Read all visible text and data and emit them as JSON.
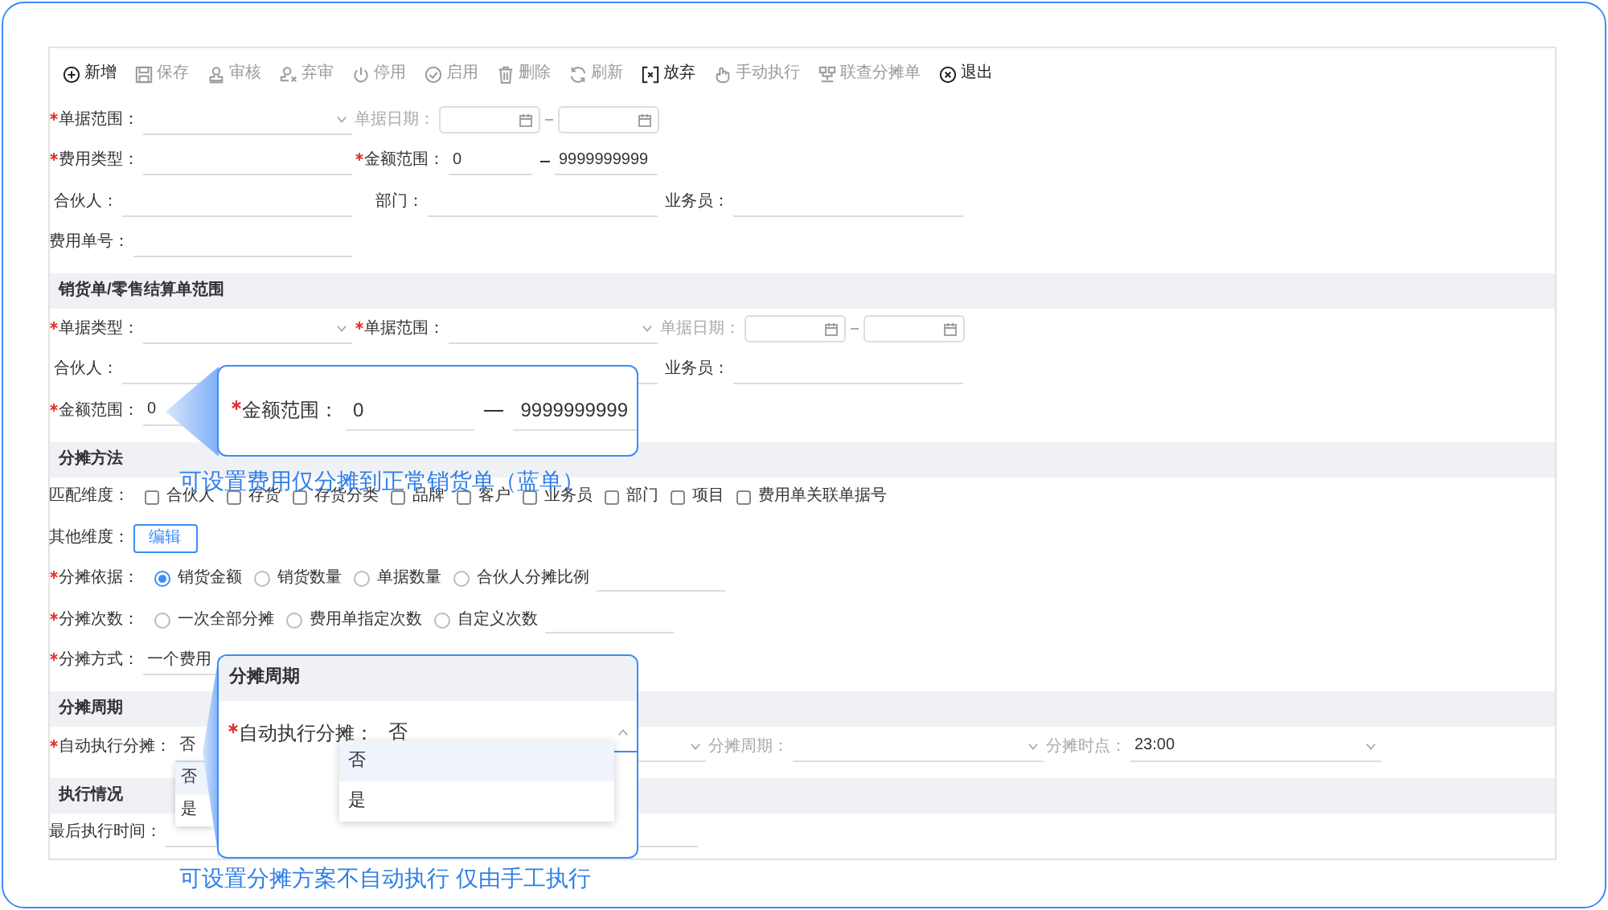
{
  "toolbar": [
    {
      "label": "新增",
      "disabled": false
    },
    {
      "label": "保存",
      "disabled": true
    },
    {
      "label": "审核",
      "disabled": true
    },
    {
      "label": "弃审",
      "disabled": true
    },
    {
      "label": "停用",
      "disabled": true
    },
    {
      "label": "启用",
      "disabled": true
    },
    {
      "label": "删除",
      "disabled": true
    },
    {
      "label": "刷新",
      "disabled": true
    },
    {
      "label": "放弃",
      "disabled": false
    },
    {
      "label": "手动执行",
      "disabled": true
    },
    {
      "label": "联查分摊单",
      "disabled": true
    },
    {
      "label": "退出",
      "disabled": false
    }
  ],
  "sections": [
    {
      "rows": [
        [
          {
            "kind": "select",
            "label": "单据范围：",
            "required": true
          },
          {
            "kind": "date_range",
            "label": "单据日期：",
            "required": false,
            "disabled": true
          }
        ],
        [
          {
            "kind": "text",
            "label": "费用类型：",
            "required": true
          },
          {
            "kind": "range",
            "label": "金额范围：",
            "required": true,
            "min": "0",
            "max": "9999999999"
          }
        ],
        [
          {
            "kind": "text",
            "label": "合伙人：",
            "required": false
          },
          {
            "kind": "text",
            "label": "部门：",
            "required": false
          },
          {
            "kind": "text",
            "label": "业务员：",
            "required": false
          }
        ],
        [
          {
            "kind": "text",
            "label": "费用单号：",
            "required": false
          }
        ]
      ]
    },
    {
      "title": "销货单/零售结算单范围",
      "rows": [
        [
          {
            "kind": "select",
            "label": "单据类型：",
            "required": true
          },
          {
            "kind": "select",
            "label": "单据范围：",
            "required": true
          },
          {
            "kind": "date_range",
            "label": "单据日期：",
            "required": false,
            "disabled": true
          }
        ],
        [
          {
            "kind": "text",
            "label": "合伙人：",
            "required": false
          },
          {
            "kind": "text"
          },
          {
            "kind": "text",
            "label": "业务员：",
            "required": false
          }
        ],
        [
          {
            "kind": "range",
            "label": "金额范围：",
            "required": true,
            "min": "0"
          }
        ]
      ]
    },
    {
      "title": "分摊方法",
      "rows": [
        [
          {
            "kind": "checkboxes",
            "label": "匹配维度：",
            "required": false,
            "options": [
              {
                "label": "合伙人",
                "checked": false
              },
              {
                "label": "存货",
                "checked": false
              },
              {
                "label": "存货分类",
                "checked": false
              },
              {
                "label": "品牌",
                "checked": false
              },
              {
                "label": "客户",
                "checked": false
              },
              {
                "label": "业务员",
                "checked": false
              },
              {
                "label": "部门",
                "checked": false
              },
              {
                "label": "项目",
                "checked": false
              },
              {
                "label": "费用单关联单据号",
                "checked": false
              }
            ]
          }
        ],
        [
          {
            "kind": "button",
            "label": "其他维度：",
            "required": false,
            "button": "编辑"
          }
        ],
        [
          {
            "kind": "radios",
            "label": "分摊依据：",
            "required": true,
            "input": true,
            "options": [
              {
                "label": "销货金额",
                "selected": true
              },
              {
                "label": "销货数量",
                "selected": false
              },
              {
                "label": "单据数量",
                "selected": false
              },
              {
                "label": "合伙人分摊比例",
                "selected": false
              }
            ]
          }
        ],
        [
          {
            "kind": "radios",
            "label": "分摊次数：",
            "required": true,
            "input": true,
            "options": [
              {
                "label": "一次全部分摊",
                "selected": false
              },
              {
                "label": "费用单指定次数",
                "selected": false
              },
              {
                "label": "自定义次数",
                "selected": false
              }
            ]
          }
        ],
        [
          {
            "kind": "text",
            "label": "分摊方式：",
            "required": true,
            "value": "一个费用"
          }
        ]
      ]
    },
    {
      "title": "分摊周期",
      "rows": [
        [
          {
            "kind": "select",
            "label": "自动执行分摊：",
            "required": true,
            "value": "否",
            "open": true,
            "options": [
              {
                "label": "否",
                "selected": true
              },
              {
                "label": "是",
                "selected": false
              }
            ]
          },
          {
            "kind": "select",
            "label": "分摊周期：",
            "required": false,
            "disabled": true
          },
          {
            "kind": "select",
            "label": "分摊时点：",
            "required": false,
            "disabled": true,
            "value": "23:00"
          }
        ]
      ]
    },
    {
      "title": "执行情况",
      "rows": [
        [
          {
            "kind": "text",
            "label": "最后执行时间：",
            "required": false
          }
        ]
      ]
    }
  ],
  "callouts": [
    {
      "caption": "可设置费用仅分摊到正常销货单（蓝单）",
      "field": {
        "kind": "range",
        "label": "金额范围：",
        "required": true,
        "min": "0",
        "max": "9999999999"
      }
    },
    {
      "title": "分摊周期",
      "caption": "可设置分摊方案不自动执行 仅由手工执行",
      "field": {
        "kind": "select",
        "label": "自动执行分摊：",
        "required": true,
        "value": "否",
        "open": true,
        "options": [
          {
            "label": "否",
            "selected": true
          },
          {
            "label": "是",
            "selected": false
          }
        ]
      }
    }
  ]
}
